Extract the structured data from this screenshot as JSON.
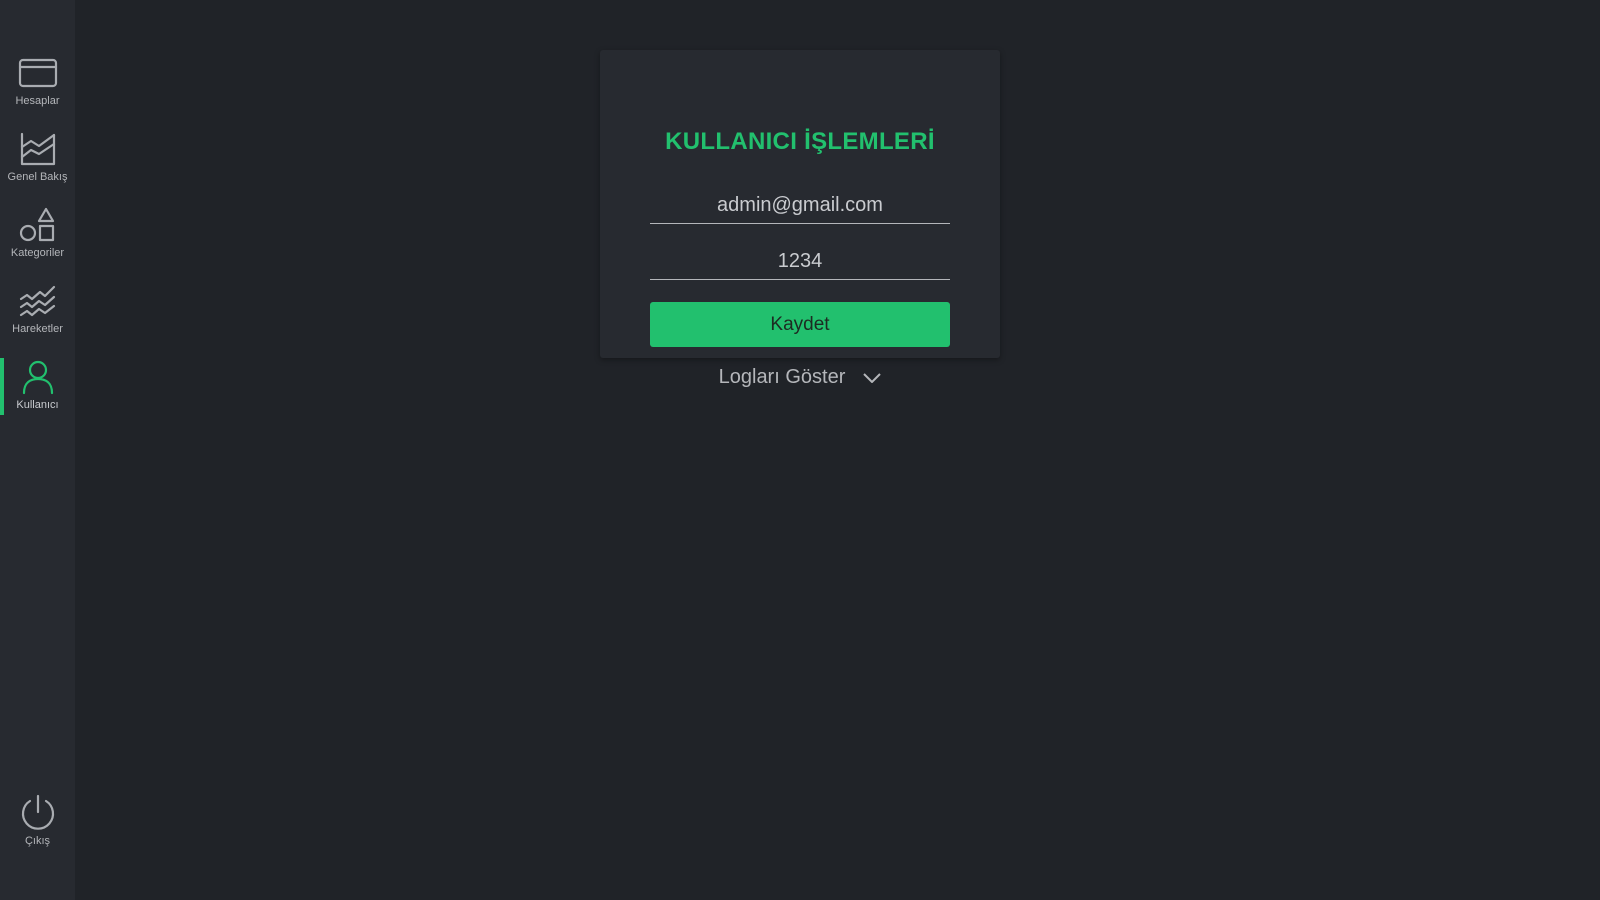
{
  "sidebar": {
    "items": [
      {
        "label": "Hesaplar",
        "icon": "credit-card-icon"
      },
      {
        "label": "Genel Bakış",
        "icon": "area-chart-icon"
      },
      {
        "label": "Kategoriler",
        "icon": "shapes-icon"
      },
      {
        "label": "Hareketler",
        "icon": "trend-lines-icon"
      },
      {
        "label": "Kullanıcı",
        "icon": "user-icon",
        "active": true
      }
    ],
    "logout": {
      "label": "Çıkış",
      "icon": "power-icon"
    }
  },
  "card": {
    "title": "KULLANICI İŞLEMLERİ",
    "email_value": "admin@gmail.com",
    "password_value": "1234",
    "save_label": "Kaydet",
    "logs_label": "Logları Göster"
  },
  "colors": {
    "accent": "#22c06e",
    "background": "#202328",
    "panel": "#272a30"
  }
}
